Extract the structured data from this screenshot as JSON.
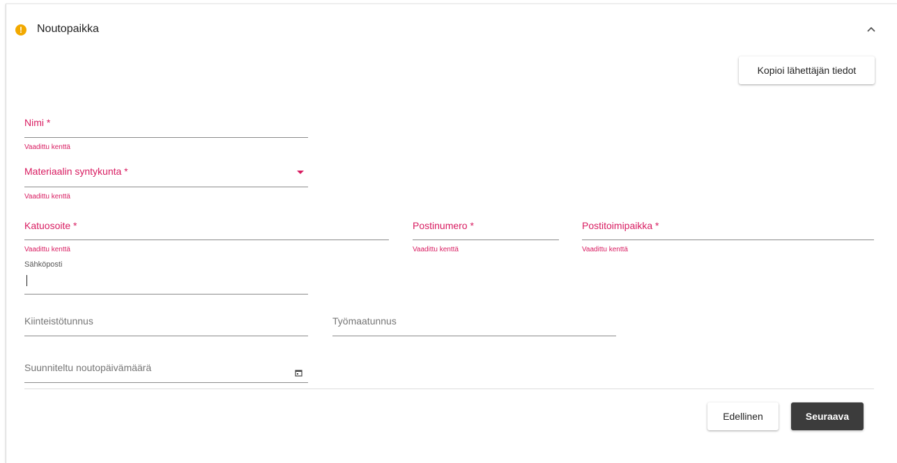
{
  "header": {
    "title": "Noutopaikka",
    "status_icon": "warning-icon",
    "collapse_icon": "chevron-up-icon"
  },
  "actions": {
    "copy_sender_label": "Kopioi lähettäjän tiedot"
  },
  "form": {
    "name": {
      "label": "Nimi *",
      "helper": "Vaadittu kenttä"
    },
    "material_origin": {
      "label": "Materiaalin syntykunta *",
      "helper": "Vaadittu kenttä"
    },
    "street": {
      "label": "Katuosoite *",
      "helper": "Vaadittu kenttä"
    },
    "postal_code": {
      "label": "Postinumero *",
      "helper": "Vaadittu kenttä"
    },
    "post_office": {
      "label": "Postitoimipaikka *",
      "helper": "Vaadittu kenttä"
    },
    "email": {
      "label": "Sähköposti",
      "value": ""
    },
    "property_id": {
      "label": "Kiinteistötunnus"
    },
    "site_id": {
      "label": "Työmaatunnus"
    },
    "planned_date": {
      "label": "Suunniteltu noutopäivämäärä"
    }
  },
  "footer": {
    "prev_label": "Edellinen",
    "next_label": "Seuraava"
  },
  "colors": {
    "required": "#d81b60",
    "warning": "#f2a900",
    "primary_button": "#3c3c3c"
  }
}
